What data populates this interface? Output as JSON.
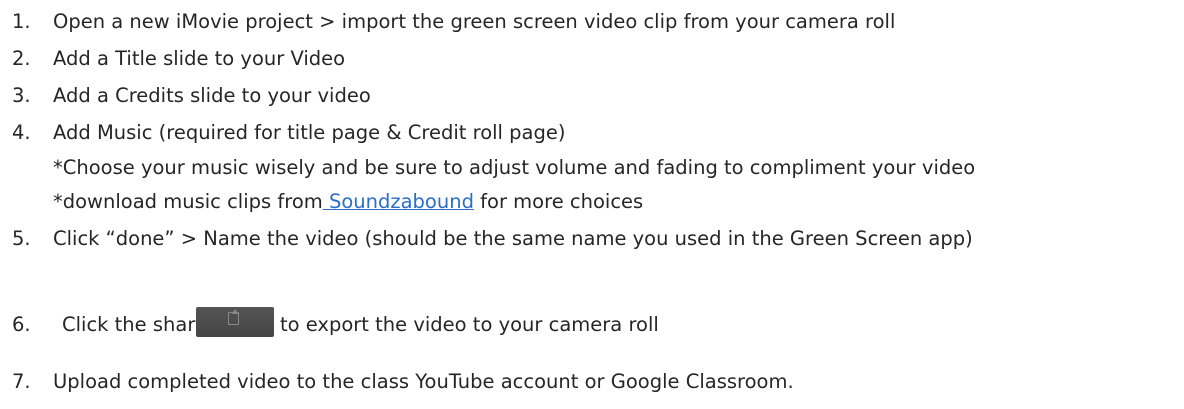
{
  "steps": [
    {
      "num": "1.",
      "text": "Open a new iMovie project > import the green screen video clip from your camera roll"
    },
    {
      "num": "2.",
      "text": "Add a Title slide to your Video"
    },
    {
      "num": "3.",
      "text": "Add a Credits slide to your video"
    },
    {
      "num": "4.",
      "text": "Add Music (required for title page & Credit roll page)",
      "sub1": "*Choose your music wisely and be sure to adjust volume and fading to compliment your video",
      "sub2_prefix": "*download music clips from",
      "sub2_link": " Soundzabound",
      "sub2_suffix": " for more choices"
    },
    {
      "num": "5.",
      "text": "Click “done” > Name the video  (should be the same name you used in the Green Screen app)"
    },
    {
      "num": "6.",
      "text_before": "Click the share arrow",
      "text_after": "to export the video to your camera roll",
      "icon": "share-icon"
    },
    {
      "num": "7.",
      "text": "Upload completed video to the class YouTube account or Google Classroom."
    }
  ]
}
